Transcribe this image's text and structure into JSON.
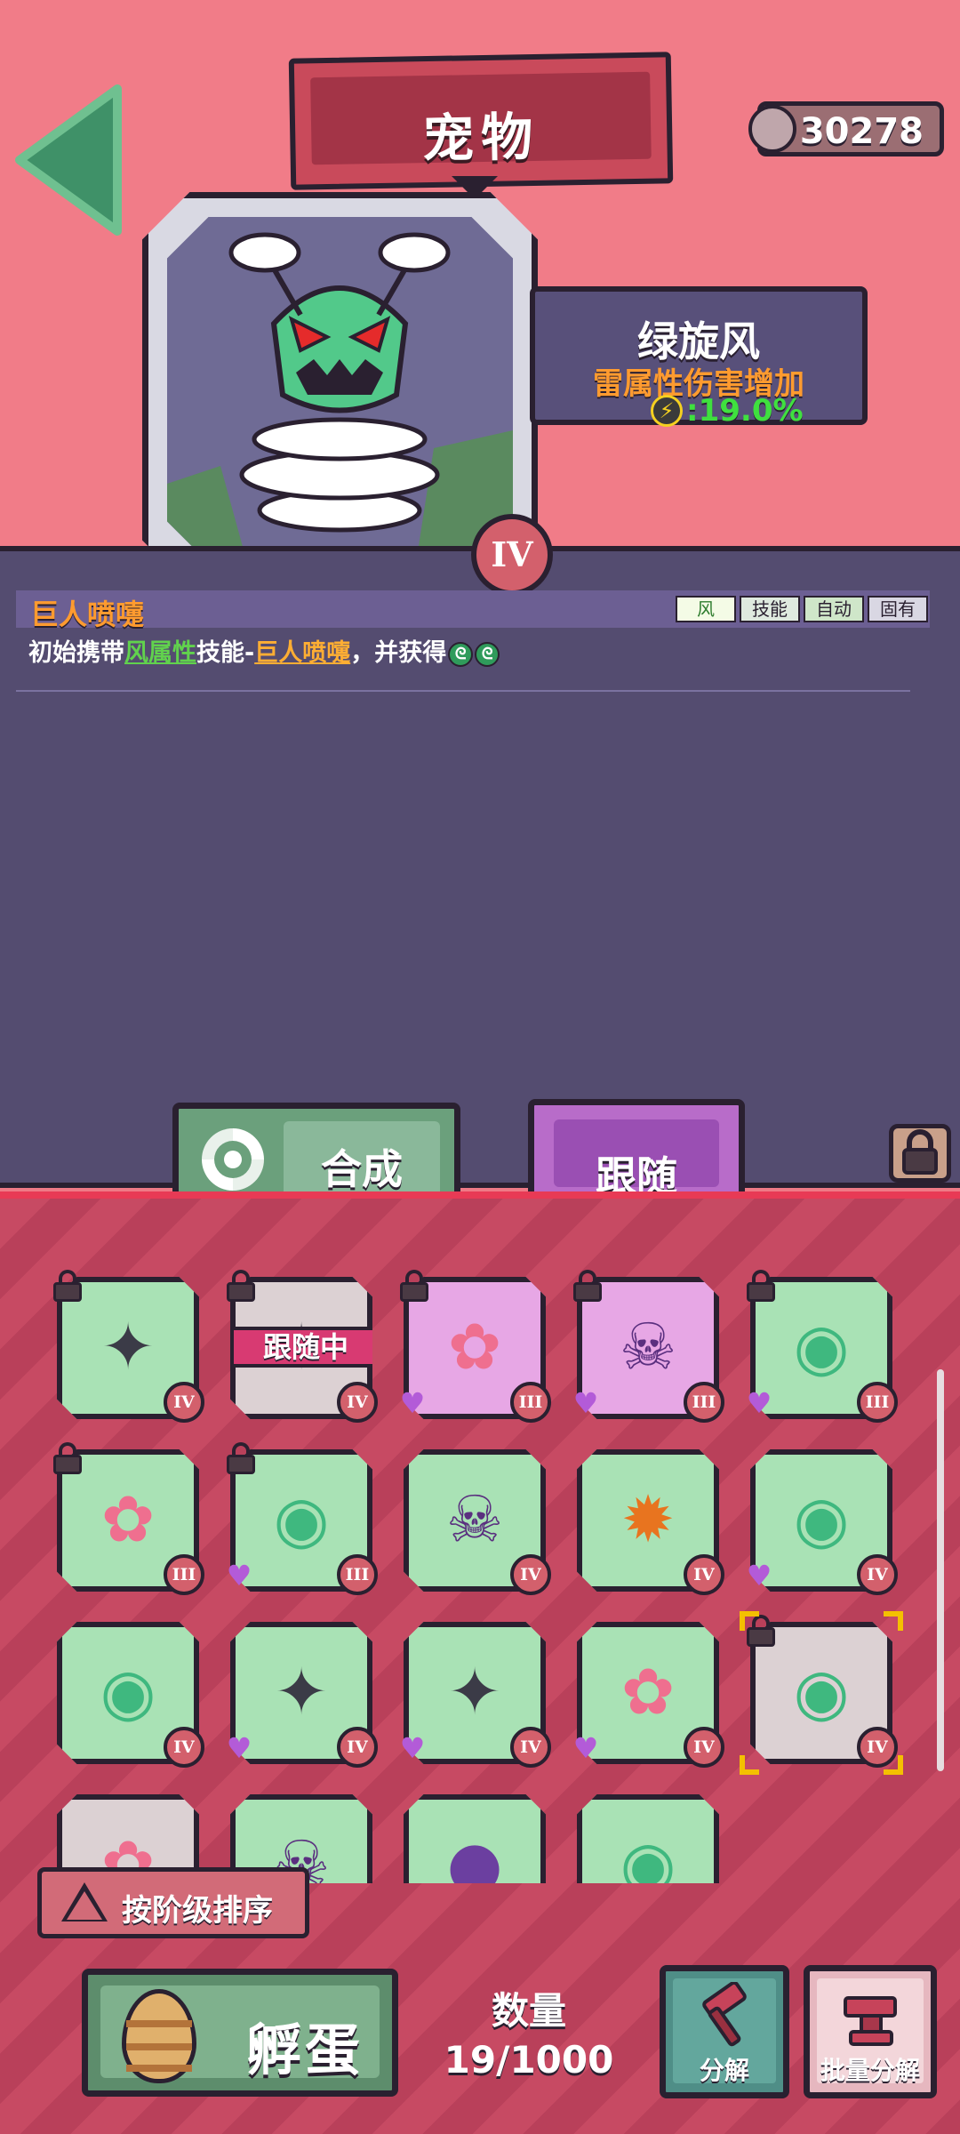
{
  "header": {
    "title": "宠物",
    "coins": "30278"
  },
  "pet": {
    "name": "绿旋风",
    "attribute": "雷属性伤害增加",
    "attribute_value": ":19.0%",
    "rank": "IV"
  },
  "skill": {
    "name": "巨人喷嚏",
    "tags": [
      "风",
      "技能",
      "自动",
      "固有"
    ],
    "desc_prefix": "初始携带",
    "desc_element": "风属性",
    "desc_mid": "技能-",
    "desc_skill": "巨人喷嚏",
    "desc_suffix": "，并获得"
  },
  "actions": {
    "merge_label": "合成",
    "follow_label": "跟随"
  },
  "grid": {
    "following_label": "跟随中",
    "cells": [
      {
        "pet": "drone",
        "rank": "IV",
        "bg": "green",
        "locked": true,
        "heart": false
      },
      {
        "pet": "drone",
        "rank": "IV",
        "bg": "gray",
        "locked": true,
        "heart": false,
        "following": true
      },
      {
        "pet": "fairy",
        "rank": "III",
        "bg": "pink",
        "locked": true,
        "heart": true
      },
      {
        "pet": "skull",
        "rank": "III",
        "bg": "pink",
        "locked": true,
        "heart": true
      },
      {
        "pet": "tornado",
        "rank": "III",
        "bg": "green",
        "locked": true,
        "heart": true
      },
      {
        "pet": "fairy",
        "rank": "III",
        "bg": "green",
        "locked": true,
        "heart": false
      },
      {
        "pet": "tornado",
        "rank": "III",
        "bg": "green",
        "locked": true,
        "heart": true
      },
      {
        "pet": "skull",
        "rank": "IV",
        "bg": "green",
        "locked": false,
        "heart": false
      },
      {
        "pet": "pumpkin",
        "rank": "IV",
        "bg": "green",
        "locked": false,
        "heart": false
      },
      {
        "pet": "tornado",
        "rank": "IV",
        "bg": "green",
        "locked": false,
        "heart": true
      },
      {
        "pet": "tornado",
        "rank": "IV",
        "bg": "green",
        "locked": false,
        "heart": false
      },
      {
        "pet": "drone",
        "rank": "IV",
        "bg": "green",
        "locked": false,
        "heart": true
      },
      {
        "pet": "drone",
        "rank": "IV",
        "bg": "green",
        "locked": false,
        "heart": true
      },
      {
        "pet": "fairy",
        "rank": "IV",
        "bg": "green",
        "locked": false,
        "heart": true
      },
      {
        "pet": "tornado",
        "rank": "IV",
        "bg": "gray",
        "locked": true,
        "heart": false,
        "selected": true
      },
      {
        "pet": "fairy",
        "rank": "",
        "bg": "gray",
        "locked": false,
        "heart": false
      },
      {
        "pet": "skull",
        "rank": "",
        "bg": "green",
        "locked": false,
        "heart": false
      },
      {
        "pet": "monster",
        "rank": "",
        "bg": "green",
        "locked": false,
        "heart": false
      },
      {
        "pet": "tornado",
        "rank": "",
        "bg": "green",
        "locked": false,
        "heart": false
      }
    ]
  },
  "footer": {
    "sort_label": "按阶级排序",
    "hatch_label": "孵蛋",
    "count_label": "数量",
    "count_value": "19/1000",
    "decompose_label": "分解",
    "batch_decompose_label": "批量分解"
  },
  "colors": {
    "top_bg": "#f17c88",
    "panel_purple": "#544c70",
    "accent_green": "#3fe03f",
    "accent_orange": "#ff9b2f",
    "cell_green": "#a9e2b5",
    "cell_pink": "#e7a7e5"
  },
  "icons": {
    "back": "back-arrow-icon",
    "coin": "coin-icon",
    "merge": "swirl-icon",
    "lock": "lock-icon",
    "egg": "egg-icon",
    "hammer": "hammer-icon",
    "anvil": "anvil-icon"
  }
}
